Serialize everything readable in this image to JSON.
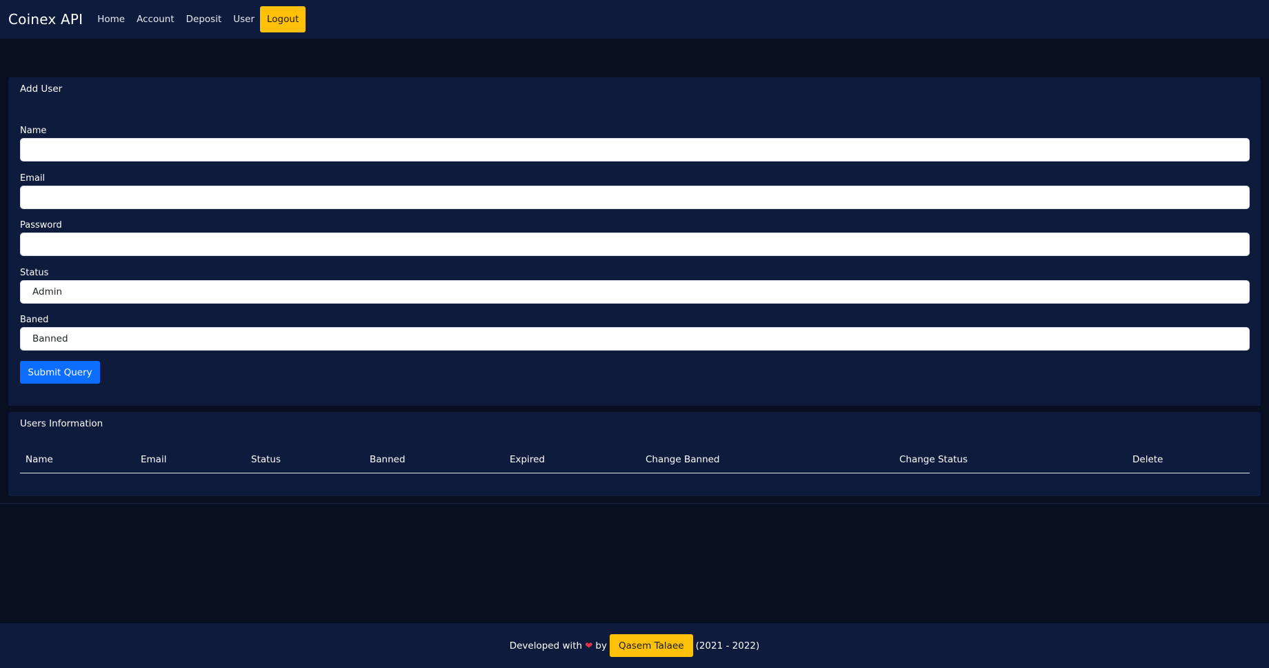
{
  "navbar": {
    "brand": "Coinex API",
    "links": [
      "Home",
      "Account",
      "Deposit",
      "User"
    ],
    "logout_label": "Logout"
  },
  "add_user": {
    "title": "Add User",
    "name_label": "Name",
    "name_value": "",
    "email_label": "Email",
    "email_value": "",
    "password_label": "Password",
    "password_value": "",
    "status_label": "Status",
    "status_selected": "Admin",
    "banned_label": "Baned",
    "banned_selected": "Banned",
    "submit_label": "Submit Query"
  },
  "users_info": {
    "title": "Users Information",
    "columns": [
      "Name",
      "Email",
      "Status",
      "Banned",
      "Expired",
      "Change Banned",
      "Change Status",
      "Delete"
    ],
    "rows": []
  },
  "footer": {
    "prefix": "Developed with",
    "heart": "❤",
    "by": "by",
    "author": "Qasem Talaee",
    "years": "(2021 - 2022)"
  },
  "colors": {
    "background": "#090f20",
    "surface": "#0e1b3d",
    "accent_yellow": "#ffc107",
    "primary_blue": "#0d6efd",
    "heart_red": "#e0344a"
  }
}
